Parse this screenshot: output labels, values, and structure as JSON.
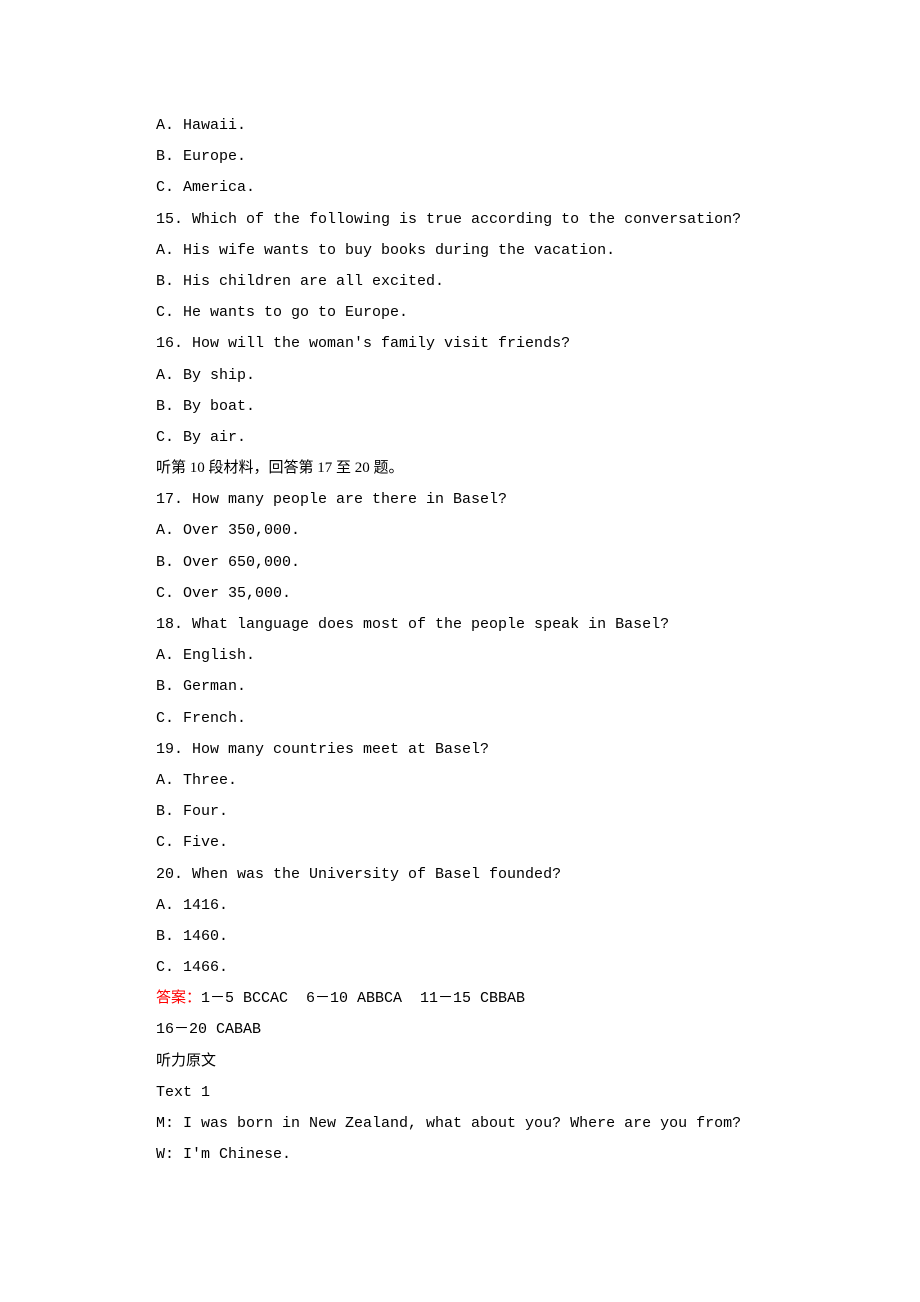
{
  "q14_choices": {
    "a": "A. Hawaii.",
    "b": "B. Europe.",
    "c": "C. America."
  },
  "q15": {
    "stem": "15. Which of the following is true according to the conversation?",
    "a": "A. His wife wants to buy books during the vacation.",
    "b": "B. His children are all excited.",
    "c": "C. He wants to go to Europe."
  },
  "q16": {
    "stem": "16. How will the woman's family visit friends?",
    "a": "A. By ship.",
    "b": "B. By boat.",
    "c": "C. By air."
  },
  "section_instruction": "听第 10 段材料，回答第 17 至 20 题。",
  "q17": {
    "stem": "17. How many people are there in Basel?",
    "a": "A. Over 350,000.",
    "b": "B. Over 650,000.",
    "c": "C. Over 35,000."
  },
  "q18": {
    "stem": "18. What language does most of the people speak in Basel?",
    "a": "A. English.",
    "b": "B. German.",
    "c": "C. French."
  },
  "q19": {
    "stem": "19. How many countries meet at Basel?",
    "a": "A. Three.",
    "b": "B. Four.",
    "c": "C. Five."
  },
  "q20": {
    "stem": "20. When was the University of Basel founded?",
    "a": "A. 1416.",
    "b": "B. 1460.",
    "c": "C. 1466."
  },
  "answer": {
    "label": "答案：",
    "line1": "1－5 BCCAC  6－10 ABBCA  11－15 CBBAB",
    "line2": "16－20 CABAB"
  },
  "transcript": {
    "heading": "听力原文",
    "text1_label": "Text 1",
    "m": "M: I was born in New Zealand, what about you? Where are you from?",
    "w": "W: I'm Chinese."
  }
}
